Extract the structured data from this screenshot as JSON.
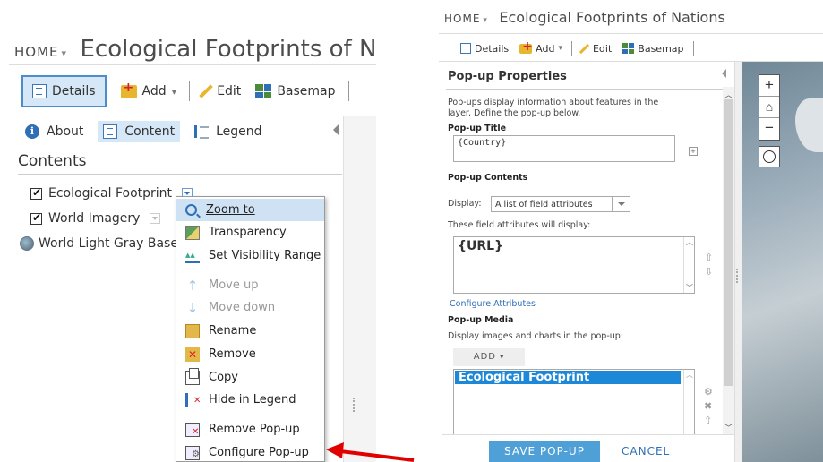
{
  "left": {
    "home_label": "HOME",
    "home_caret": "▾",
    "title": "Ecological Footprints of Natic",
    "toolbar": {
      "details": "Details",
      "add": "Add",
      "add_caret": "▾",
      "edit": "Edit",
      "basemap": "Basemap"
    },
    "subtabs": {
      "about": "About",
      "content": "Content",
      "legend": "Legend"
    },
    "contents_heading": "Contents",
    "layers": [
      {
        "name": "Ecological Footprint",
        "checked": true
      },
      {
        "name": "World Imagery",
        "checked": true
      },
      {
        "name": "World Light Gray Base",
        "checked": false
      }
    ],
    "context_menu": [
      {
        "label": "Zoom to",
        "icon": "zoom-icon",
        "state": "hover"
      },
      {
        "label": "Transparency",
        "icon": "transparency-icon",
        "state": "normal"
      },
      {
        "label": "Set Visibility Range",
        "icon": "visibility-range-icon",
        "state": "normal"
      },
      {
        "label": "Move up",
        "icon": "arrow-up-icon",
        "state": "disabled"
      },
      {
        "label": "Move down",
        "icon": "arrow-down-icon",
        "state": "disabled"
      },
      {
        "label": "Rename",
        "icon": "rename-icon",
        "state": "normal"
      },
      {
        "label": "Remove",
        "icon": "remove-icon",
        "state": "normal"
      },
      {
        "label": "Copy",
        "icon": "copy-icon",
        "state": "normal"
      },
      {
        "label": "Hide in Legend",
        "icon": "hide-legend-icon",
        "state": "normal"
      },
      {
        "label": "Remove Pop-up",
        "icon": "remove-popup-icon",
        "state": "normal"
      },
      {
        "label": "Configure Pop-up",
        "icon": "configure-popup-icon",
        "state": "normal"
      }
    ]
  },
  "right": {
    "home_label": "HOME",
    "home_caret": "▾",
    "title": "Ecological Footprints of Nations",
    "toolbar": {
      "details": "Details",
      "add": "Add",
      "add_caret": "▾",
      "edit": "Edit",
      "basemap": "Basemap"
    },
    "popup": {
      "heading": "Pop-up Properties",
      "desc_line1": "Pop-ups display information about features in the",
      "desc_line2": "layer. Define the pop-up below.",
      "title_label": "Pop-up Title",
      "title_value": "{Country}",
      "contents_label": "Pop-up Contents",
      "display_label": "Display:",
      "display_value": "A list of field attributes",
      "fields_label": "These field attributes will display:",
      "fields_value": "{URL}",
      "configure_link": "Configure Attributes",
      "media_label": "Pop-up Media",
      "media_desc": "Display images and charts in the pop-up:",
      "add_button": "ADD",
      "add_caret": "▾",
      "media_item": "Ecological Footprint",
      "save_button": "SAVE POP-UP",
      "cancel_button": "CANCEL"
    },
    "map_controls": {
      "zoom_in": "+",
      "home": "⌂",
      "zoom_out": "−"
    }
  },
  "colors": {
    "accent_blue": "#2f6fb5",
    "selection_blue": "#1e88d8",
    "save_button": "#50a0d8",
    "arrow_red": "#e00000"
  }
}
